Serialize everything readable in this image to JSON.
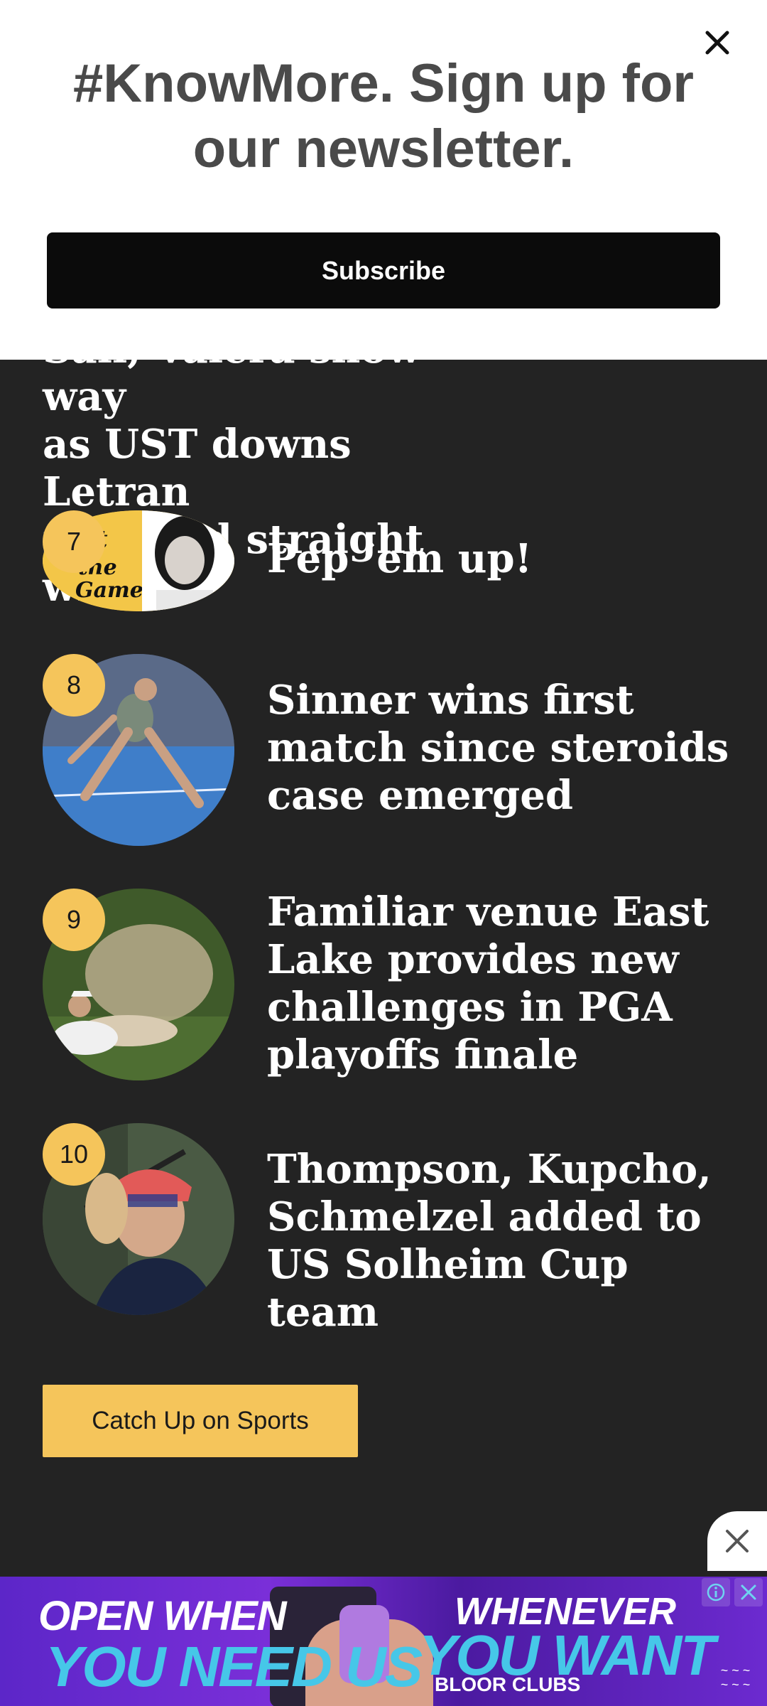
{
  "newsletter": {
    "title_line1": "#KnowMore. Sign up for",
    "title_line2": "our newsletter.",
    "subscribe_label": "Subscribe",
    "close_icon": "close-icon"
  },
  "partial_item": {
    "headline_hidden_line": "Sali, Valera show way",
    "headline_line2": "as UST downs Letran",
    "headline_line3": "for third straight win"
  },
  "list": [
    {
      "rank": "7",
      "headline": "Pep ‘em up!",
      "thumb": "column-logo-thumbnail"
    },
    {
      "rank": "8",
      "headline": "Sinner wins first match since steroids case emerged",
      "thumb": "tennis-thumbnail"
    },
    {
      "rank": "9",
      "headline": "Familiar venue East Lake provides new challenges in PGA playoffs finale",
      "thumb": "golf-bunker-thumbnail"
    },
    {
      "rank": "10",
      "headline": "Thompson, Kupcho, Schmelzel added to US Solheim Cup team",
      "thumb": "golfer-thumbnail"
    }
  ],
  "cta_label": "Catch Up on Sports",
  "ad": {
    "text_a": "OPEN WHEN",
    "text_b": "YOU NEED US",
    "text_c": "WHENEVER",
    "text_d": "YOU WANT",
    "text_e": "BLOOR CLUBS"
  },
  "colors": {
    "background": "#232323",
    "accent": "#f5c55b",
    "subscribe_bg": "#0b0b0b"
  }
}
